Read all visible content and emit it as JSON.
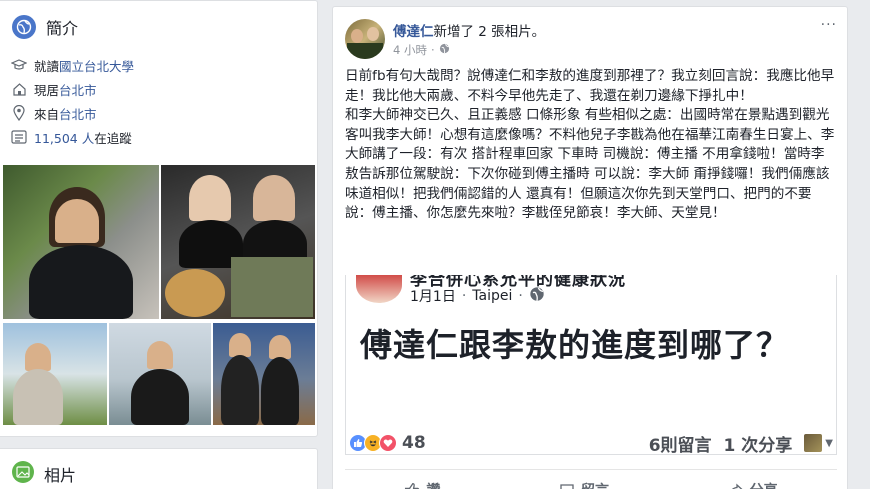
{
  "intro": {
    "title": "簡介",
    "rows": [
      {
        "icon": "graduation-cap-icon",
        "prefix": "就讀",
        "link": "國立台北大學",
        "suffix": ""
      },
      {
        "icon": "home-icon",
        "prefix": "現居",
        "link": "台北市",
        "suffix": ""
      },
      {
        "icon": "location-pin-icon",
        "prefix": "來自",
        "link": "台北市",
        "suffix": ""
      },
      {
        "icon": "followers-icon",
        "prefix": "",
        "link": "11,504 人",
        "suffix": "在追蹤"
      }
    ]
  },
  "photos_section": {
    "title": "相片"
  },
  "post": {
    "author": "傅達仁",
    "action": "新增了 2 張相片。",
    "time": "4 小時",
    "more": "···",
    "text_lines": [
      "日前fb有句大哉問？說傅達仁和李敖的進度到那裡了？我立刻回言說：我應比他早走！我比他大兩歲、不料今早他先走了、我還在剃刀邊緣下掙扎中！",
      "和李大師神交已久、且正義感 口條形象 有些相似之處：出國時常在景點遇到觀光客叫我李大師！心想有這麼像嗎？不料他兒子李戡為他在福華江南春生日宴上、李大師講了一段：有次 搭計程車回家 下車時 司機說：傅主播 不用拿錢啦！當時李敖告訴那位駕駛說：下次你碰到傅主播時 可以說：李大師 甭掙錢囉！我們倆應該味道相似！把我們倆認錯的人 還真有！但願這次你先到天堂門口、把門的不要說：傅主播、你怎麼先來啦？李戡侄兒節哀！李大師、天堂見！"
    ],
    "shared": {
      "top_text": "李合併心系允平的健康狀況",
      "date": "1月1日",
      "sep": "·",
      "place": "Taipei",
      "sep2": "·",
      "body": "傅達仁跟李敖的進度到哪了？"
    },
    "reactions": {
      "count": "48",
      "comments": "6則留言",
      "shares": "1 次分享"
    },
    "actions": {
      "like": "讚",
      "comment": "留言",
      "share": "分享"
    }
  }
}
